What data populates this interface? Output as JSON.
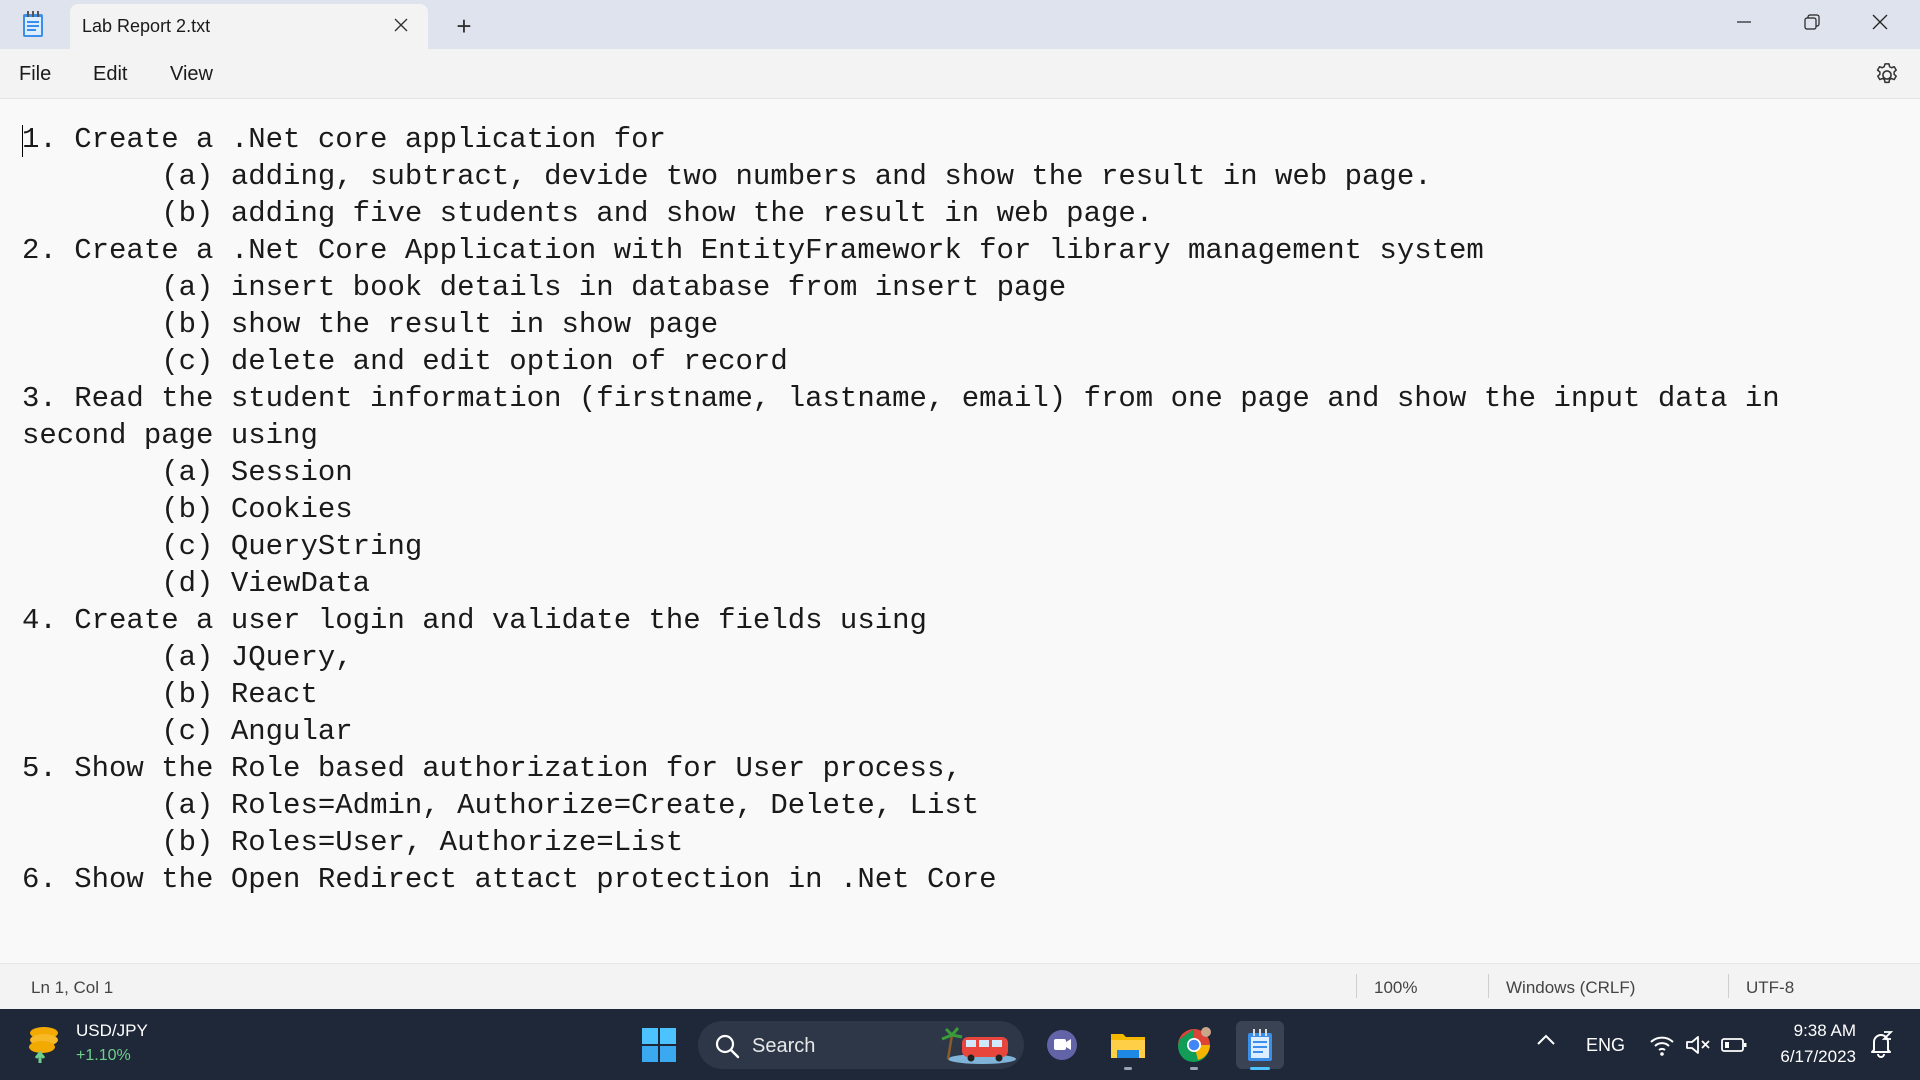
{
  "window": {
    "tab_title": "Lab Report 2.txt",
    "new_tab_label": "+"
  },
  "menu": {
    "file": "File",
    "edit": "Edit",
    "view": "View"
  },
  "editor": {
    "content": "1. Create a .Net core application for\n\t(a) adding, subtract, devide two numbers and show the result in web page.\n\t(b) adding five students and show the result in web page.\n2. Create a .Net Core Application with EntityFramework for library management system\n\t(a) insert book details in database from insert page\n\t(b) show the result in show page\n\t(c) delete and edit option of record\n3. Read the student information (firstname, lastname, email) from one page and show the input data in second page using\n\t(a) Session\n\t(b) Cookies\n\t(c) QueryString\n\t(d) ViewData\n4. Create a user login and validate the fields using\n\t(a) JQuery,\n\t(b) React\n\t(c) Angular\n5. Show the Role based authorization for User process,\n\t(a) Roles=Admin, Authorize=Create, Delete, List\n\t(b) Roles=User, Authorize=List\n6. Show the Open Redirect attact protection in .Net Core"
  },
  "statusbar": {
    "position": "Ln 1, Col 1",
    "zoom": "100%",
    "line_ending": "Windows (CRLF)",
    "encoding": "UTF-8"
  },
  "taskbar": {
    "widget_title": "USD/JPY",
    "widget_change": "+1.10%",
    "search_label": "Search",
    "language": "ENG",
    "time": "9:38 AM",
    "date": "6/17/2023"
  },
  "colors": {
    "titlebar": "#dfe3ee",
    "taskbar": "#1f2838",
    "accent": "#4cc2ff"
  }
}
